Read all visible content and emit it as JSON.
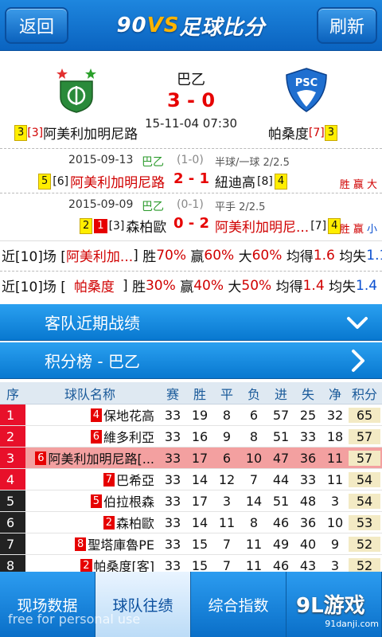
{
  "topbar": {
    "back_label": "返回",
    "refresh_label": "刷新",
    "logo_prefix": "90",
    "logo_vs": "VS",
    "logo_suffix": "足球比分"
  },
  "match": {
    "league": "巴乙",
    "score": "3 - 0",
    "datetime": "15-11-04 07:30",
    "home": {
      "pos": "3",
      "rank": "[3]",
      "name": "阿美利加明尼路"
    },
    "away": {
      "name": "帕桑度",
      "rank": "[7]",
      "pos": "3"
    }
  },
  "h2h": [
    {
      "date": "2015-09-13",
      "league": "巴乙",
      "ht": "(1-0)",
      "handicap": "半球/一球  2/2.5",
      "home_pos": "5",
      "home_rank": "[6]",
      "home": "阿美利加明尼路",
      "result": "2 - 1",
      "away": "紐迪高",
      "away_rank": "[8]",
      "away_pos": "4",
      "tags": "胜 赢 大"
    },
    {
      "date": "2015-09-09",
      "league": "巴乙",
      "ht": "(0-1)",
      "handicap": "平手  2/2.5",
      "home_pos": "2",
      "home_red": "1",
      "home_rank": "[3]",
      "home": "森柏歐",
      "result": "0 - 2",
      "away": "阿美利加明尼...",
      "away_rank": "[7]",
      "away_pos": "4",
      "tags": "胜 赢 小"
    }
  ],
  "summary": [
    {
      "prefix": "近[10]场 [",
      "team": "阿美利加...",
      "suffix": "]",
      "w_label": "胜",
      "w": "70%",
      "d_label": "赢",
      "d": "60%",
      "o_label": "大",
      "o": "60%",
      "gf_label": "均得",
      "gf": "1.6",
      "ga_label": "均失",
      "ga": "1.1"
    },
    {
      "prefix": "近[10]场 [",
      "team": "帕桑度",
      "suffix": "]",
      "w_label": "胜",
      "w": "30%",
      "d_label": "赢",
      "d": "40%",
      "o_label": "大",
      "o": "50%",
      "gf_label": "均得",
      "gf": "1.4",
      "ga_label": "均失",
      "ga": "1.4"
    }
  ],
  "sections": {
    "recent": "客队近期战绩",
    "standings": "积分榜 - 巴乙"
  },
  "standings": {
    "headers": [
      "序",
      "球队名称",
      "赛",
      "胜",
      "平",
      "负",
      "进",
      "失",
      "净",
      "积分"
    ],
    "rows": [
      {
        "no": "1",
        "rk": "4",
        "team": "保地花高",
        "p": "33",
        "w": "19",
        "d": "8",
        "l": "6",
        "gf": "57",
        "ga": "25",
        "gd": "32",
        "pts": "65",
        "color": "#e8102a"
      },
      {
        "no": "2",
        "rk": "6",
        "team": "維多利亞",
        "p": "33",
        "w": "16",
        "d": "9",
        "l": "8",
        "gf": "51",
        "ga": "33",
        "gd": "18",
        "pts": "57",
        "color": "#e8102a"
      },
      {
        "no": "3",
        "rk": "6",
        "team": "阿美利加明尼路[...",
        "p": "33",
        "w": "17",
        "d": "6",
        "l": "10",
        "gf": "47",
        "ga": "36",
        "gd": "11",
        "pts": "57",
        "color": "#e8102a",
        "hl": true
      },
      {
        "no": "4",
        "rk": "7",
        "team": "巴希亞",
        "p": "33",
        "w": "14",
        "d": "12",
        "l": "7",
        "gf": "44",
        "ga": "33",
        "gd": "11",
        "pts": "54",
        "color": "#e8102a"
      },
      {
        "no": "5",
        "rk": "5",
        "team": "伯拉根森",
        "p": "33",
        "w": "17",
        "d": "3",
        "l": "14",
        "gf": "51",
        "ga": "48",
        "gd": "3",
        "pts": "54",
        "color": "#222"
      },
      {
        "no": "6",
        "rk": "2",
        "team": "森柏歐",
        "p": "33",
        "w": "14",
        "d": "11",
        "l": "8",
        "gf": "46",
        "ga": "36",
        "gd": "10",
        "pts": "53",
        "color": "#222"
      },
      {
        "no": "7",
        "rk": "8",
        "team": "聖塔庫魯PE",
        "p": "33",
        "w": "15",
        "d": "7",
        "l": "11",
        "gf": "49",
        "ga": "40",
        "gd": "9",
        "pts": "52",
        "color": "#222"
      },
      {
        "no": "8",
        "rk": "2",
        "team": "帕桑度[客]",
        "p": "33",
        "w": "15",
        "d": "7",
        "l": "11",
        "gf": "46",
        "ga": "43",
        "gd": "3",
        "pts": "52",
        "color": "#222"
      }
    ]
  },
  "tabs": [
    "现场数据",
    "球队往绩",
    "综合指数",
    ""
  ],
  "watermark": "free for personal use",
  "brand": {
    "name": "9L游戏",
    "url": "91danji.com"
  }
}
